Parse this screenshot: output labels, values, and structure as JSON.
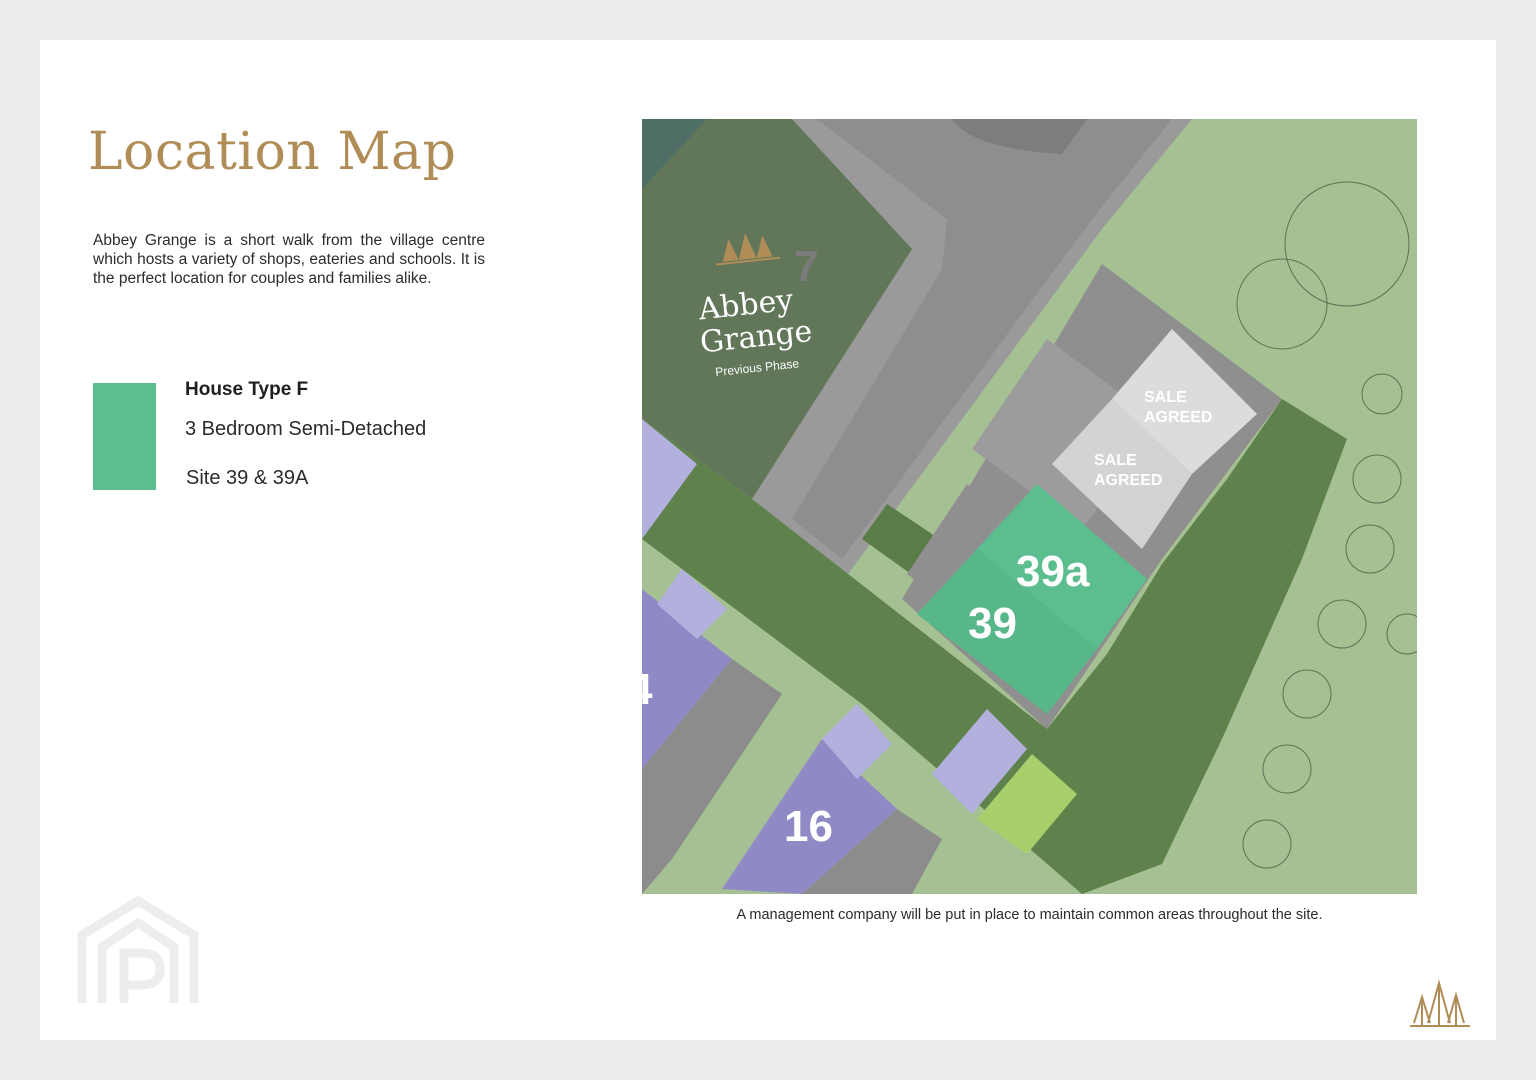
{
  "page": {
    "title": "Location Map",
    "intro": "Abbey Grange is a short walk from the village centre which hosts a variety of shops, eateries and schools. It is the perfect location for couples and families alike."
  },
  "legend": {
    "color": "#5cbd8e",
    "house_type": "House Type F",
    "description": "3  Bedroom Semi-Detached",
    "sites": "Site 39 & 39A"
  },
  "map": {
    "brand_line1": "Abbey",
    "brand_line2": "Grange",
    "brand_sub": "Previous Phase",
    "plot_labels": {
      "plot_7": "7",
      "plot_39a": "39a",
      "plot_39": "39",
      "plot_16": "16",
      "plot_4_partial": "4",
      "sale_agreed_1_line1": "SALE",
      "sale_agreed_1_line2": "AGREED",
      "sale_agreed_2_line1": "SALE",
      "sale_agreed_2_line2": "AGREED"
    },
    "colors": {
      "site_highlight": "#5cbd8e",
      "sold_plot": "#dcdcdc",
      "other_plot": "#8f8ac6",
      "garden": "#a5c193",
      "dark_garden": "#5f814c",
      "road": "#9a9a9a",
      "brand_gold": "#b08d57"
    },
    "icons": [
      "tree-logo-icon",
      "tree-outline-icon"
    ]
  },
  "caption": "A management company will be put in place to maintain common areas throughout the site.",
  "branding": {
    "watermark_icon": "house-p-watermark-icon",
    "corner_icon": "trees-logo-icon"
  }
}
